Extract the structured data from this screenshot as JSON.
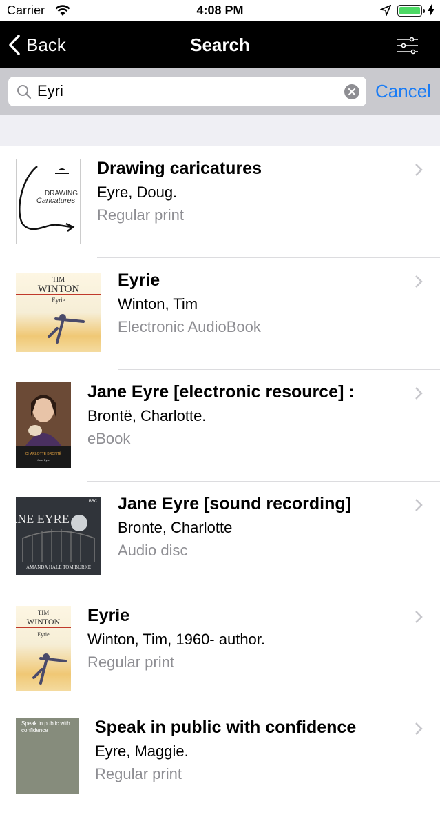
{
  "status": {
    "carrier": "Carrier",
    "time": "4:08 PM"
  },
  "nav": {
    "back_label": "Back",
    "title": "Search"
  },
  "search": {
    "value": "Eyri",
    "cancel_label": "Cancel"
  },
  "results": [
    {
      "title": "Drawing caricatures",
      "author": "Eyre, Doug.",
      "format": "Regular print",
      "cover_title": "DRAWING",
      "cover_sub": "Caricatures"
    },
    {
      "title": "Eyrie",
      "author": "Winton, Tim",
      "format": "Electronic AudioBook",
      "cover_title": "WINTON",
      "cover_top": "TIM",
      "cover_sub": "Eyrie"
    },
    {
      "title": "Jane Eyre [electronic resource] :",
      "author": "Brontë, Charlotte.",
      "format": "eBook",
      "cover_title": "CHARLOTTE BRONTË",
      "cover_sub": "Jane Eyre"
    },
    {
      "title": "Jane Eyre [sound recording]",
      "author": "Bronte, Charlotte",
      "format": "Audio disc",
      "cover_title": "JANE EYRE",
      "cover_top": "BBC",
      "cover_sub": "AMANDA HALE    TOM BURKE"
    },
    {
      "title": "Eyrie",
      "author": "Winton, Tim, 1960- author.",
      "format": "Regular print",
      "cover_title": "WINTON",
      "cover_top": "TIM",
      "cover_sub": "Eyrie"
    },
    {
      "title": "Speak in public with confidence",
      "author": "Eyre, Maggie.",
      "format": "Regular print",
      "cover_title": "Speak in public with confidence"
    }
  ]
}
